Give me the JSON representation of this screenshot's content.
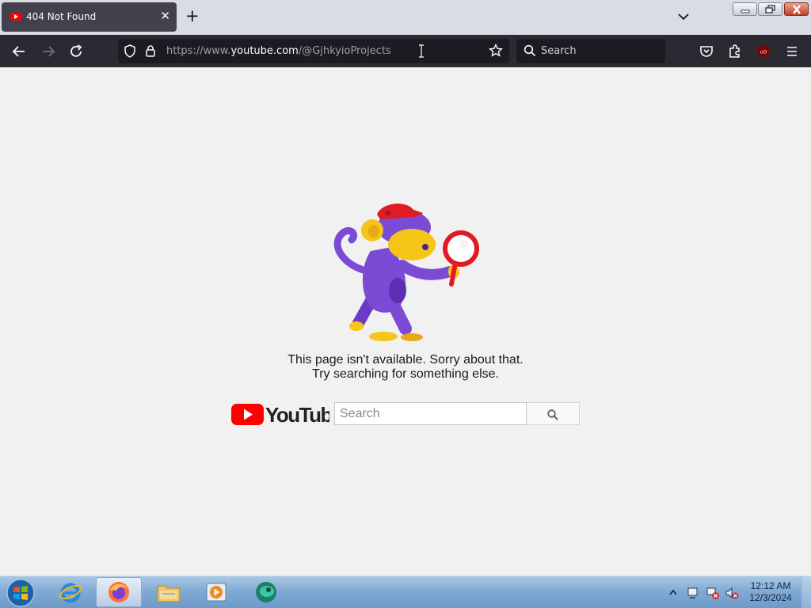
{
  "browser": {
    "tab": {
      "title": "404 Not Found",
      "favicon": "youtube-icon"
    },
    "new_tab_label": "+",
    "url": {
      "prefix": "https://www.",
      "domain": "youtube.com",
      "path": "/@GjhkyioProjects"
    },
    "search_placeholder": "Search"
  },
  "page": {
    "message_line1": "This page isn't available. Sorry about that.",
    "message_line2": "Try searching for something else.",
    "logo_text": "YouTube",
    "search_placeholder": "Search"
  },
  "taskbar": {
    "pinned": [
      "internet-explorer-icon",
      "firefox-icon",
      "file-explorer-icon",
      "media-player-icon",
      "app-icon"
    ],
    "time": "12:12 AM",
    "date": "12/3/2024"
  },
  "colors": {
    "tab_bg": "#42414d",
    "nav_bg": "#2b2a33",
    "url_bg": "#1c1b22",
    "page_bg": "#f1f1f1",
    "youtube_red": "#ff0000"
  }
}
